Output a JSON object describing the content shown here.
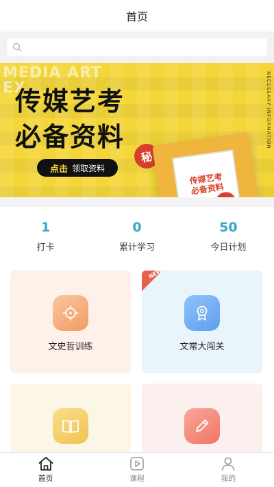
{
  "header": {
    "title": "首页"
  },
  "search": {
    "placeholder": "",
    "icon": "search-icon"
  },
  "banner": {
    "ghost_line1": "MEDIA ART",
    "ghost_line2": "EX",
    "line1": "传媒艺考",
    "line2": "必备资料",
    "seal": "秘",
    "cta_strong": "点击",
    "cta_label": "领取资料",
    "side_text": "NECESSARY INFORMATION",
    "envelope_line1": "传媒艺考",
    "envelope_line2": "必备资料",
    "colors": {
      "background": "#f4d63a",
      "envelope": "#f0b53c",
      "accent": "#d8402b"
    }
  },
  "stats": [
    {
      "value": "1",
      "label": "打卡"
    },
    {
      "value": "0",
      "label": "累计学习"
    },
    {
      "value": "50",
      "label": "今日计划"
    }
  ],
  "cards": [
    {
      "label": "文史哲训练",
      "icon": "target-icon"
    },
    {
      "label": "文常大闯关",
      "icon": "award-icon",
      "badge": "NEW"
    },
    {
      "label": "",
      "icon": "book-icon"
    },
    {
      "label": "",
      "icon": "pencil-icon"
    }
  ],
  "tabs": [
    {
      "label": "首页",
      "icon": "home-icon",
      "active": true
    },
    {
      "label": "课程",
      "icon": "play-icon",
      "active": false
    },
    {
      "label": "我的",
      "icon": "user-icon",
      "active": false
    }
  ],
  "colors": {
    "stat_number": "#3aa6c9",
    "new_badge": "#e8604b"
  }
}
